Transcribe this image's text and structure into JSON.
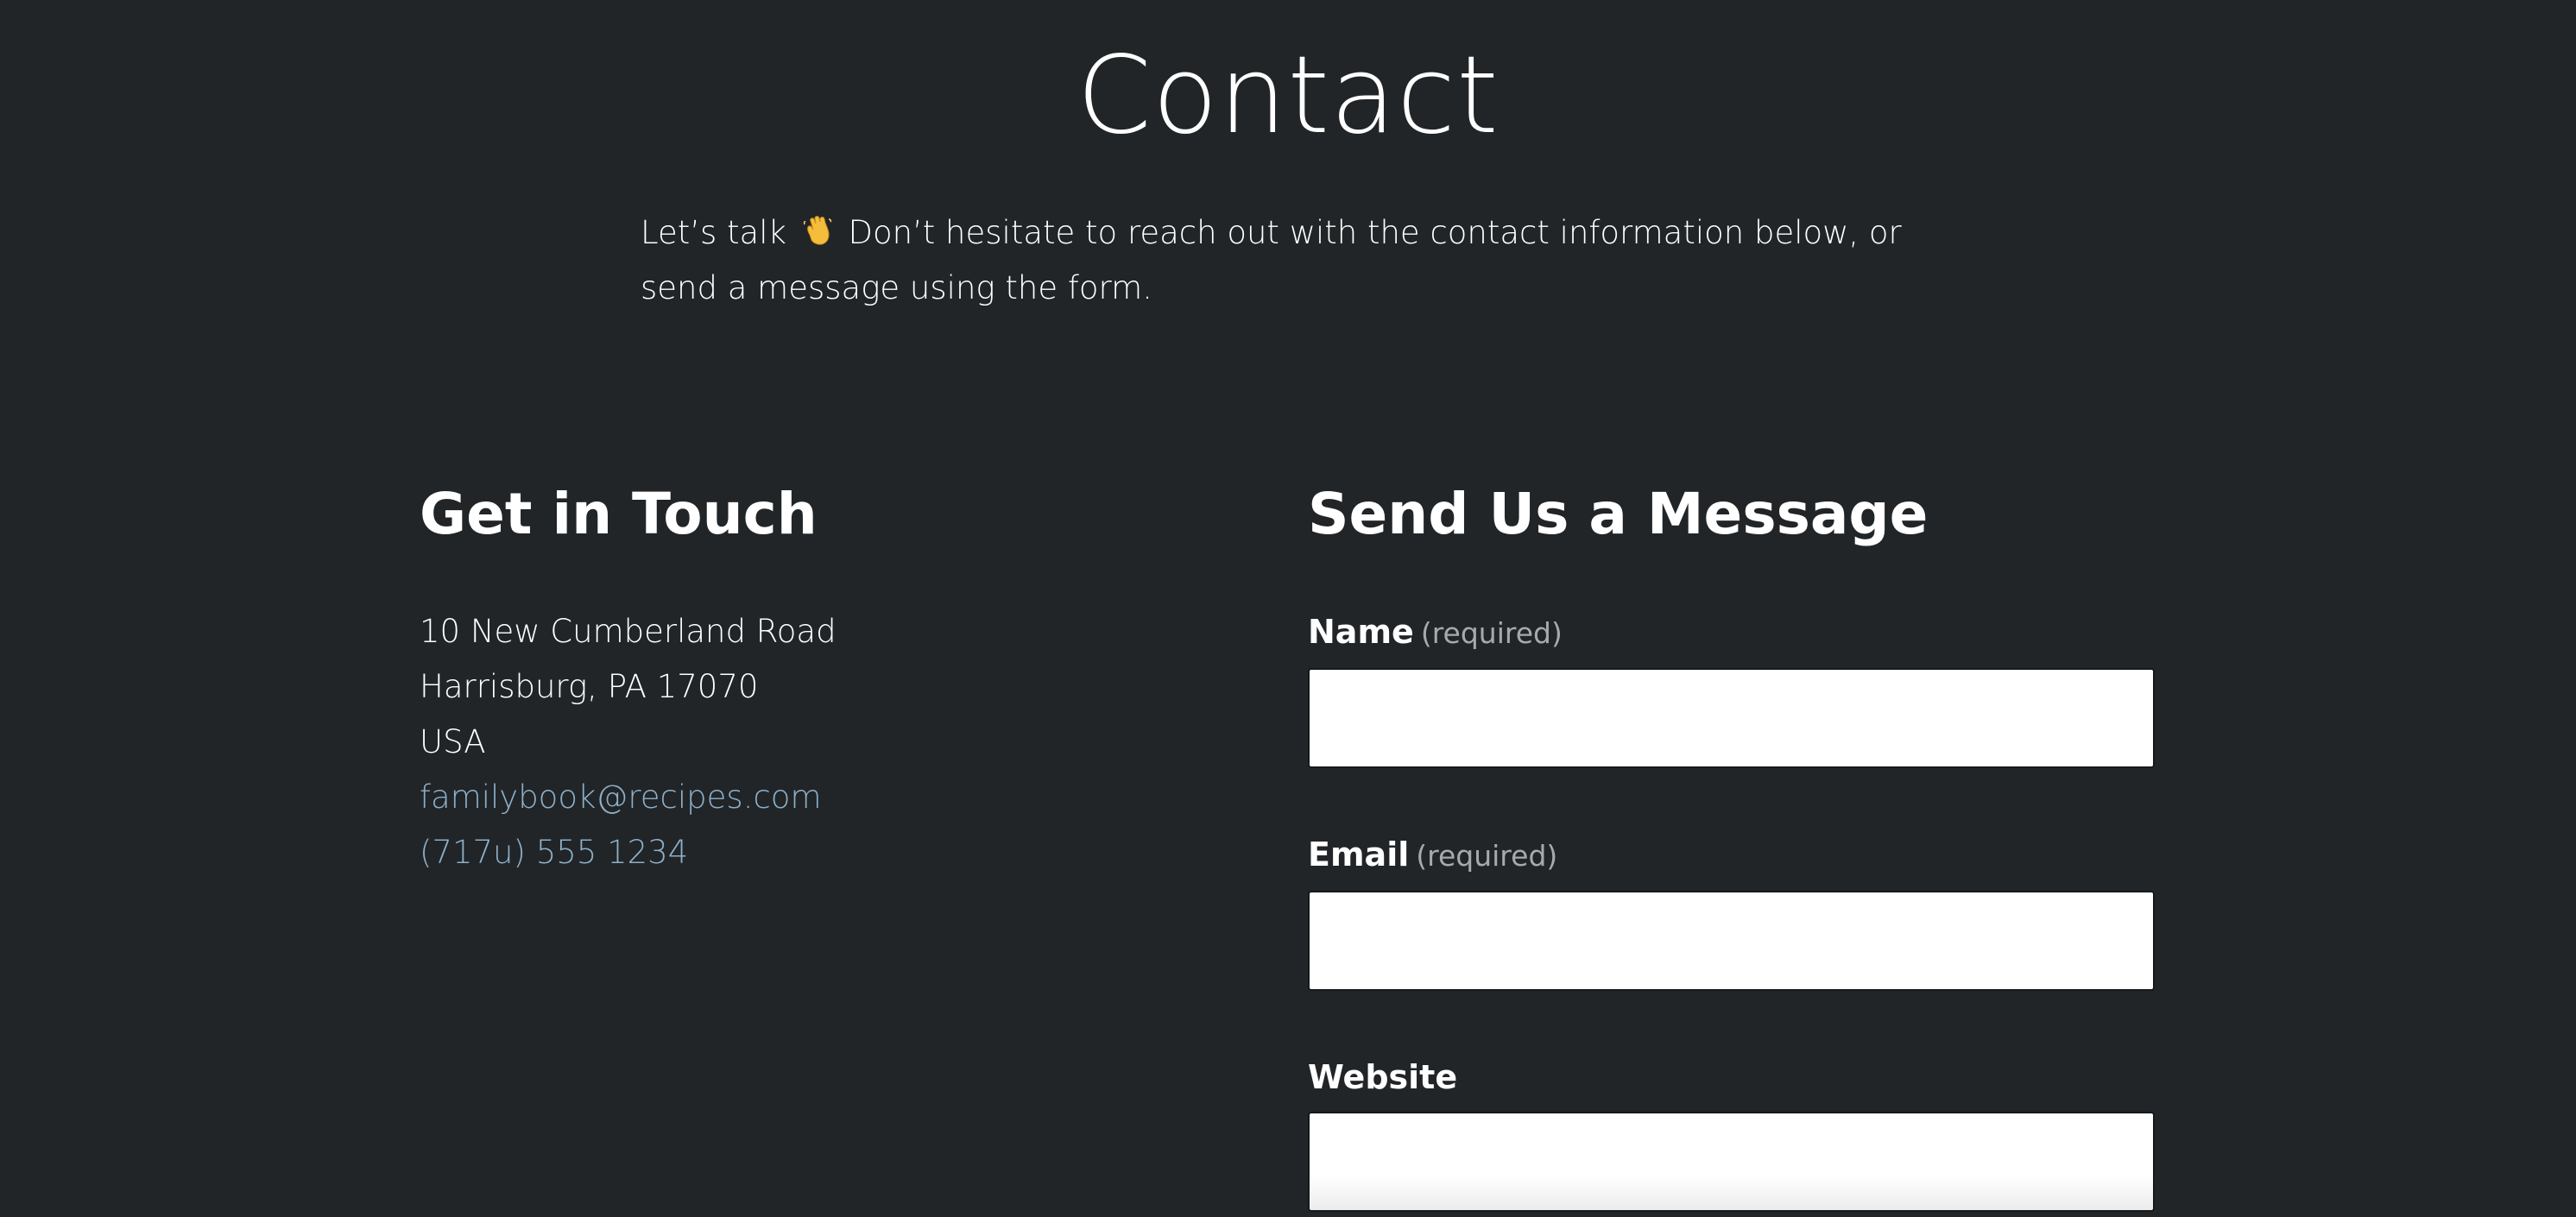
{
  "page": {
    "title": "Contact",
    "intro_before": "Let’s talk",
    "intro_after": "Don’t hesitate to reach out with the contact information below, or send a message using the form."
  },
  "get_in_touch": {
    "heading": "Get in Touch",
    "address_line1": "10 New Cumberland Road",
    "address_line2": "Harrisburg, PA 17070",
    "country": "USA",
    "email": "familybook@recipes.com",
    "phone": "(717u) 555 1234"
  },
  "form": {
    "heading": "Send Us a Message",
    "fields": [
      {
        "label": "Name",
        "required_note": "(required)",
        "value": ""
      },
      {
        "label": "Email",
        "required_note": "(required)",
        "value": ""
      },
      {
        "label": "Website",
        "value": ""
      }
    ]
  },
  "colors": {
    "background": "#212528",
    "link": "#8fb0c9",
    "muted": "#a7aaac"
  },
  "icons": {
    "intro_emoji": "waving-hand-icon"
  }
}
